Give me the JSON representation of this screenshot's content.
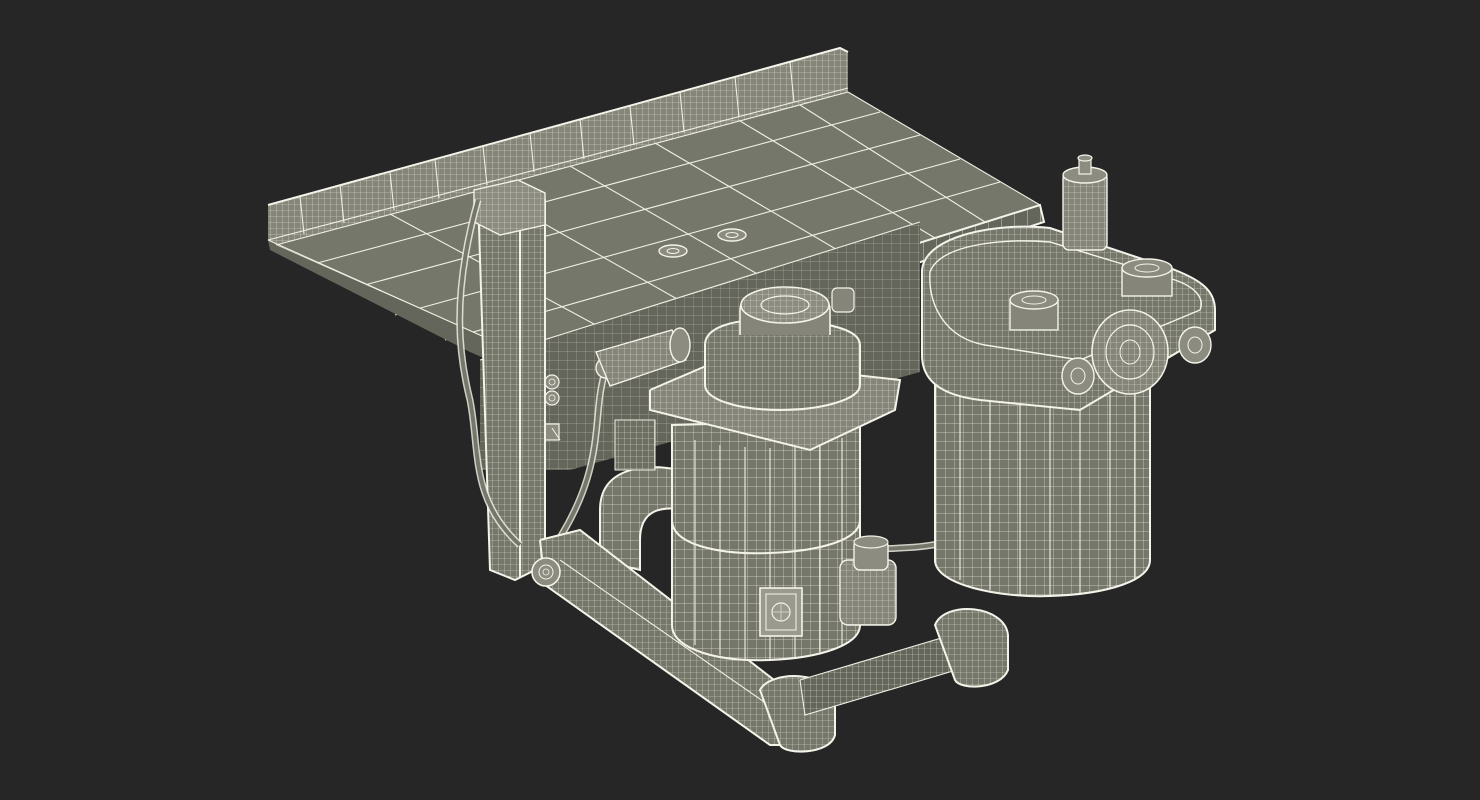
{
  "viewport": {
    "background": "#262626"
  },
  "model": {
    "style": "wireframe-on-shaded",
    "surface_color": "#76776b",
    "wire_color": "#f0efe4",
    "parts": [
      "tabletop-shelf",
      "vertical-post",
      "hoses",
      "control-knobs",
      "toggle-switch",
      "canister-left",
      "canister-right",
      "pump-head",
      "base-frame",
      "elbow-pipe"
    ]
  }
}
